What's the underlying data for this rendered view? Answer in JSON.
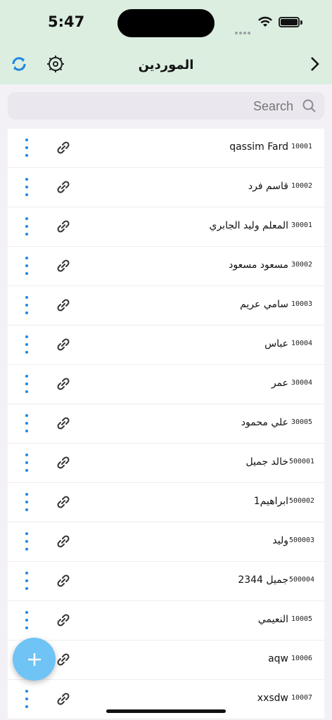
{
  "status_bar": {
    "time": "5:47"
  },
  "appbar": {
    "title": "الموردين"
  },
  "search": {
    "placeholder": "Search",
    "value": ""
  },
  "suppliers": [
    {
      "code": "10001",
      "name": "qassim Fard"
    },
    {
      "code": "10002",
      "name": "قاسم فرد"
    },
    {
      "code": "30001",
      "name": "المعلم وليد الجابري"
    },
    {
      "code": "30002",
      "name": "مسعود مسعود"
    },
    {
      "code": "10003",
      "name": "سامي عريم"
    },
    {
      "code": "10004",
      "name": "عباس"
    },
    {
      "code": "30004",
      "name": "عمر"
    },
    {
      "code": "30005",
      "name": "علي محمود"
    },
    {
      "code": "500001",
      "name": "خالد جميل"
    },
    {
      "code": "500002",
      "name": "ابراهيم1"
    },
    {
      "code": "500003",
      "name": "وليد"
    },
    {
      "code": "500004",
      "name": "جميل 2344"
    },
    {
      "code": "10005",
      "name": "النعيمي"
    },
    {
      "code": "10006",
      "name": "aqw"
    },
    {
      "code": "10007",
      "name": "xxsdw"
    }
  ],
  "colors": {
    "header_bg": "#dbeee0",
    "accent_blue": "#1e88e5",
    "fab": "#6fc3f5"
  },
  "icons": {
    "sync": "sync-icon",
    "settings": "settings-icon",
    "back": "chevron-right-icon",
    "search": "search-icon",
    "row_link": "link-icon",
    "row_more": "more-vert-icon",
    "fab": "plus-icon"
  }
}
